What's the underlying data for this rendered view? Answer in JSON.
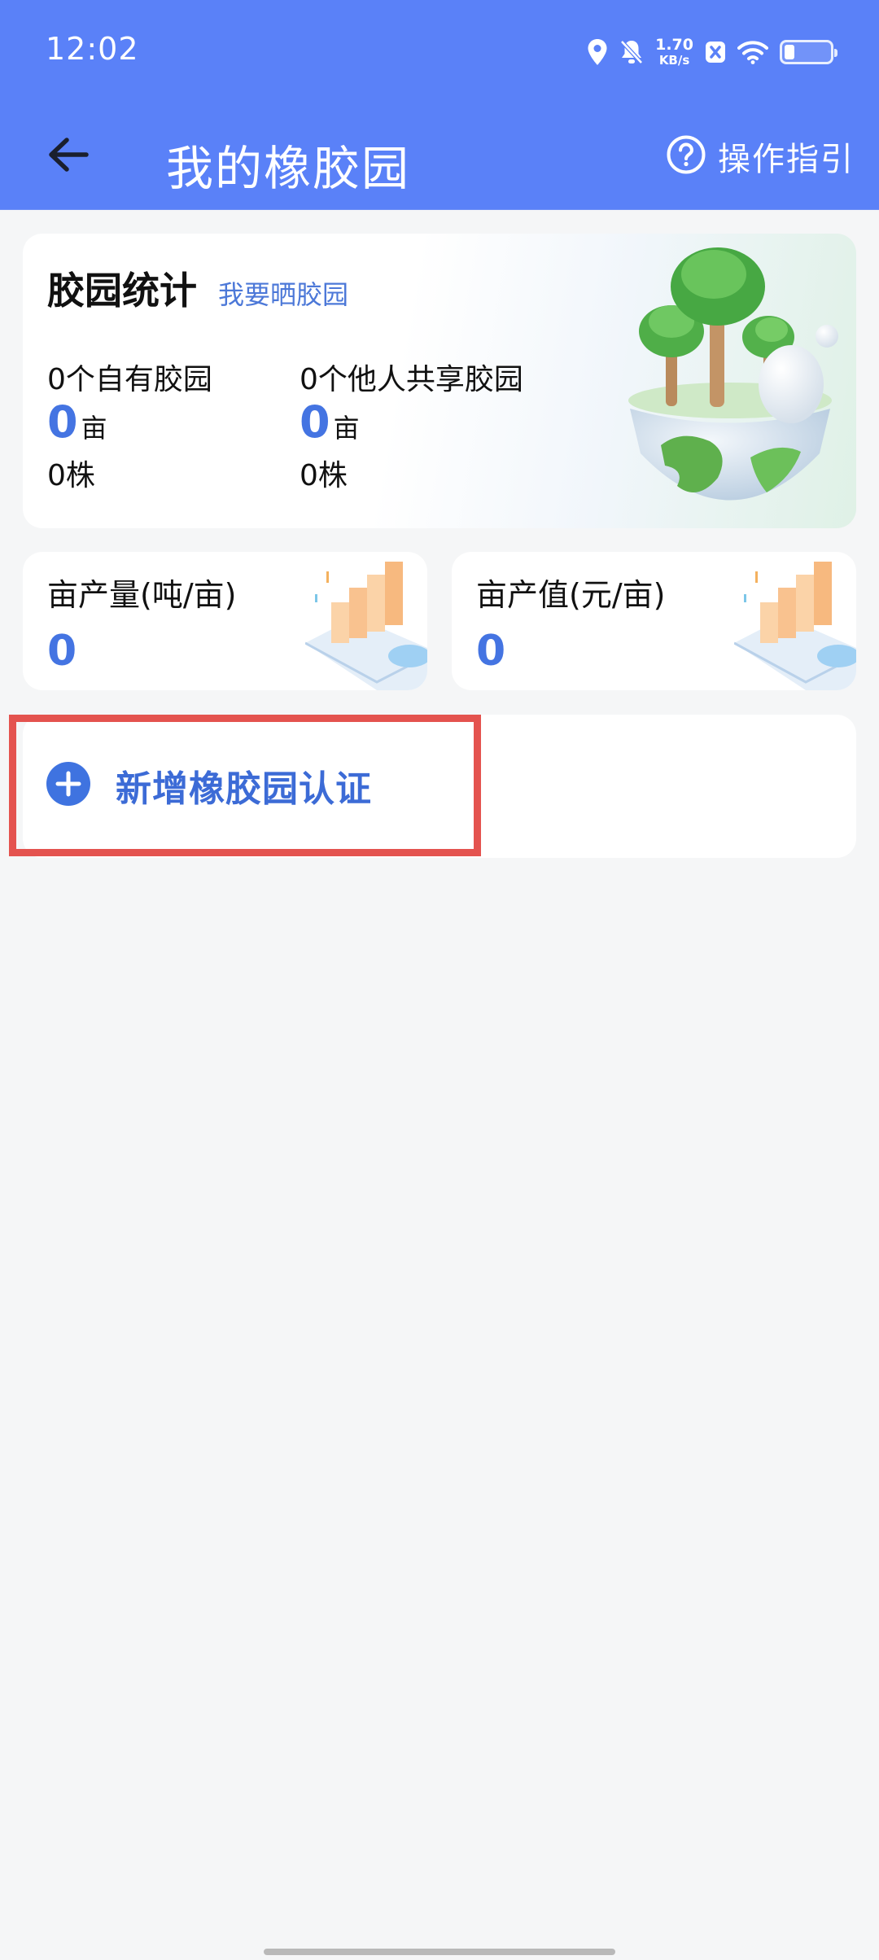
{
  "status_bar": {
    "time": "12:02",
    "net_speed_value": "1.70",
    "net_speed_unit": "KB/s",
    "battery_level": 0.2,
    "icons": [
      "location-icon",
      "mute-icon",
      "net-speed",
      "app-notification-icon",
      "wifi-icon",
      "battery-icon"
    ]
  },
  "nav": {
    "back_icon": "arrow-left-icon",
    "title": "我的橡胶园",
    "guide_icon": "question-circle-icon",
    "guide_label": "操作指引"
  },
  "stats": {
    "title": "胶园统计",
    "share_link": "我要晒胶园",
    "own": {
      "label": "0个自有胶园",
      "area_value": "0",
      "area_unit": "亩",
      "trees": "0株"
    },
    "shared": {
      "label": "0个他人共享胶园",
      "area_value": "0",
      "area_unit": "亩",
      "trees": "0株"
    }
  },
  "metrics": [
    {
      "label": "亩产量(吨/亩)",
      "value": "0"
    },
    {
      "label": "亩产值(元/亩)",
      "value": "0"
    }
  ],
  "add_certification": {
    "icon": "plus-circle-icon",
    "label": "新增橡胶园认证"
  },
  "colors": {
    "header": "#5a81f8",
    "accent": "#4474e2",
    "highlight": "#e4534f",
    "background": "#f5f6f7"
  }
}
